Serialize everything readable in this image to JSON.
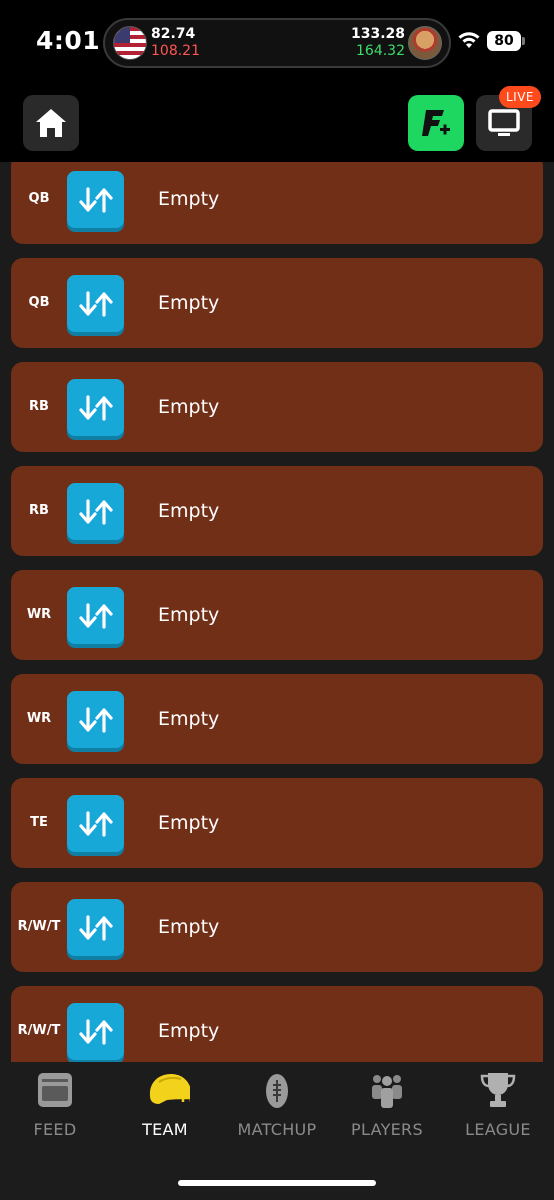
{
  "status_bar": {
    "time": "4:01",
    "left_score_top": "82.74",
    "left_score_bottom": "108.21",
    "right_score_top": "133.28",
    "right_score_bottom": "164.32",
    "battery": "80"
  },
  "header": {
    "home_icon": "home-icon",
    "fplus_icon": "f-plus-icon",
    "tv_icon": "tv-icon",
    "live_badge": "LIVE"
  },
  "roster": {
    "slots": [
      {
        "position": "QB",
        "name": "Empty"
      },
      {
        "position": "QB",
        "name": "Empty"
      },
      {
        "position": "RB",
        "name": "Empty"
      },
      {
        "position": "RB",
        "name": "Empty"
      },
      {
        "position": "WR",
        "name": "Empty"
      },
      {
        "position": "WR",
        "name": "Empty"
      },
      {
        "position": "TE",
        "name": "Empty"
      },
      {
        "position": "R/W/T",
        "name": "Empty"
      },
      {
        "position": "R/W/T",
        "name": "Empty"
      }
    ]
  },
  "bottom_nav": {
    "items": [
      {
        "label": "FEED",
        "icon": "feed-icon",
        "active": false
      },
      {
        "label": "TEAM",
        "icon": "helmet-icon",
        "active": true
      },
      {
        "label": "MATCHUP",
        "icon": "football-icon",
        "active": false
      },
      {
        "label": "PLAYERS",
        "icon": "players-icon",
        "active": false
      },
      {
        "label": "LEAGUE",
        "icon": "trophy-icon",
        "active": false
      }
    ]
  },
  "colors": {
    "slot_bg": "#722f18",
    "swap_button": "#18a8d8",
    "fplus_button": "#1ed760",
    "live_badge": "#ff4a1c",
    "team_helmet": "#f2d21b"
  }
}
